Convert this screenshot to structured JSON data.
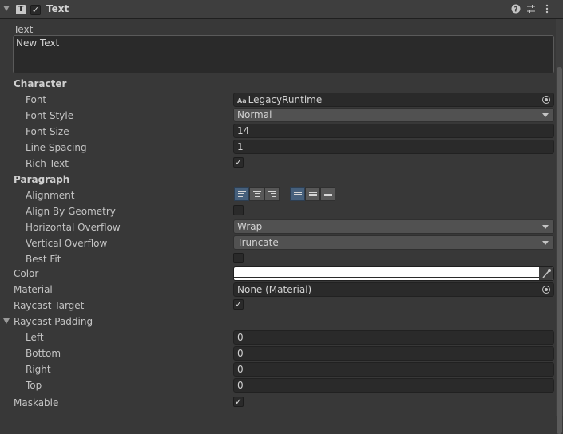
{
  "header": {
    "title": "Text",
    "type_icon": "T",
    "enabled": true,
    "icons": [
      "help-icon",
      "presets-icon",
      "more-options-icon"
    ]
  },
  "text": {
    "label": "Text",
    "value": "New Text"
  },
  "character": {
    "title": "Character",
    "font": {
      "label": "Font",
      "value": "LegacyRuntime",
      "icon": "Aa"
    },
    "font_style": {
      "label": "Font Style",
      "value": "Normal"
    },
    "font_size": {
      "label": "Font Size",
      "value": "14"
    },
    "line_spacing": {
      "label": "Line Spacing",
      "value": "1"
    },
    "rich_text": {
      "label": "Rich Text",
      "checked": true
    }
  },
  "paragraph": {
    "title": "Paragraph",
    "alignment": {
      "label": "Alignment",
      "horizontal": "left",
      "vertical": "top"
    },
    "align_by_geometry": {
      "label": "Align By Geometry",
      "checked": false
    },
    "horizontal_overflow": {
      "label": "Horizontal Overflow",
      "value": "Wrap"
    },
    "vertical_overflow": {
      "label": "Vertical Overflow",
      "value": "Truncate"
    },
    "best_fit": {
      "label": "Best Fit",
      "checked": false
    }
  },
  "color": {
    "label": "Color",
    "value": "#FFFFFF"
  },
  "material": {
    "label": "Material",
    "value": "None (Material)"
  },
  "raycast_target": {
    "label": "Raycast Target",
    "checked": true
  },
  "raycast_padding": {
    "label": "Raycast Padding",
    "left": {
      "label": "Left",
      "value": "0"
    },
    "bottom": {
      "label": "Bottom",
      "value": "0"
    },
    "right": {
      "label": "Right",
      "value": "0"
    },
    "top": {
      "label": "Top",
      "value": "0"
    }
  },
  "maskable": {
    "label": "Maskable",
    "checked": true
  },
  "check_glyph": "✓",
  "colors": {
    "background": "#383838",
    "field": "#2a2a2a",
    "accent": "#46607c"
  }
}
